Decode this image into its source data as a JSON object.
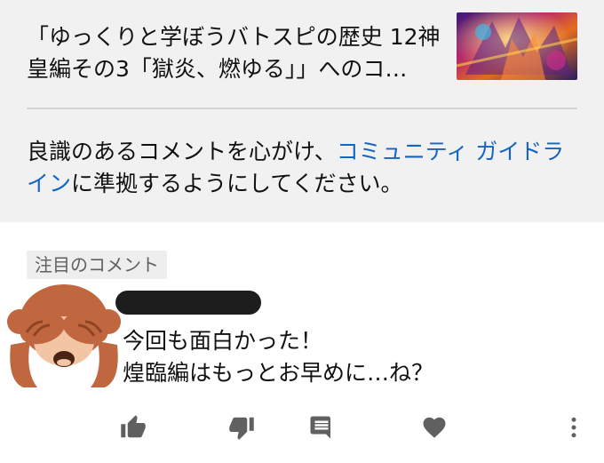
{
  "video": {
    "title": "「ゆっくりと学ぼうバトスピの歴史 12神皇編その3「獄炎、燃ゆる」」へのコ…"
  },
  "guideline": {
    "prefix": "良識のあるコメントを心がけ、",
    "link": "コミュニティ ガイドライン",
    "suffix": "に準拠するようにしてください。"
  },
  "comment": {
    "badge": "注目のコメント",
    "lines": [
      "今回も面白かった！",
      "煌臨編はもっとお早めに…ね？"
    ],
    "avatar_icon": "see-no-evil-monkey-icon"
  },
  "actions": {
    "icons": [
      "thumbs-up-icon",
      "thumbs-down-icon",
      "reply-icon",
      "heart-icon",
      "more-vert-icon"
    ]
  },
  "colors": {
    "panel_bg": "#f1f1f1",
    "link": "#1565c0",
    "icon": "#606060",
    "monkey_fur": "#c0673f",
    "monkey_face": "#f2c6a5"
  }
}
